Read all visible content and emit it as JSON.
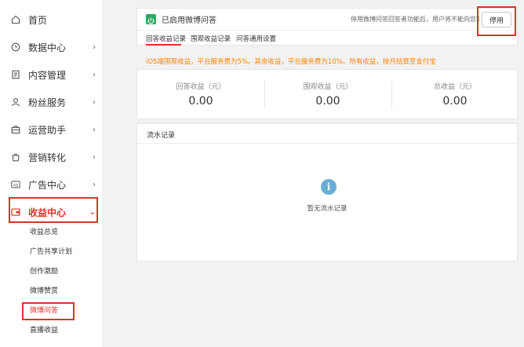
{
  "sidebar": {
    "items": [
      {
        "label": "首页",
        "icon": "home-icon",
        "has_chevron": false
      },
      {
        "label": "数据中心",
        "icon": "clock-icon",
        "has_chevron": true
      },
      {
        "label": "内容管理",
        "icon": "document-icon",
        "has_chevron": true
      },
      {
        "label": "粉丝服务",
        "icon": "user-icon",
        "has_chevron": true
      },
      {
        "label": "运营助手",
        "icon": "briefcase-icon",
        "has_chevron": true
      },
      {
        "label": "营销转化",
        "icon": "bag-icon",
        "has_chevron": true
      },
      {
        "label": "广告中心",
        "icon": "ad-icon",
        "has_chevron": true
      },
      {
        "label": "收益中心",
        "icon": "wallet-icon",
        "has_chevron": true,
        "expanded": true
      }
    ],
    "sub_items": [
      "收益总览",
      "广告共享计划",
      "创作激励",
      "微博赞赏",
      "微博问答",
      "直播收益"
    ],
    "active_sub": "微博问答",
    "ad_icon_text": "AD"
  },
  "qa": {
    "status_text": "已启用微博问答",
    "notice": "停用微博问答回答者功能后，用户将不能向您提问",
    "stop_label": "停用",
    "tabs": [
      "回答收益记录",
      "围观收益记录",
      "问答通用设置"
    ],
    "active_tab": "回答收益记录"
  },
  "note": "iOS端围观收益，平台服务费为5%。其余收益，平台服务费为10%。所有收益，按月结算至支付宝",
  "stats": [
    {
      "label": "回答收益（元）",
      "value": "0.00"
    },
    {
      "label": "围观收益（元）",
      "value": "0.00"
    },
    {
      "label": "总收益（元）",
      "value": "0.00"
    }
  ],
  "ledger": {
    "title": "流水记录",
    "empty_icon_glyph": "i",
    "empty_text": "暂无流水记录"
  },
  "colors": {
    "accent": "#e1302b",
    "warning": "#ff8200",
    "enabled_green": "#2aa960",
    "info_blue": "#6aaed6"
  }
}
